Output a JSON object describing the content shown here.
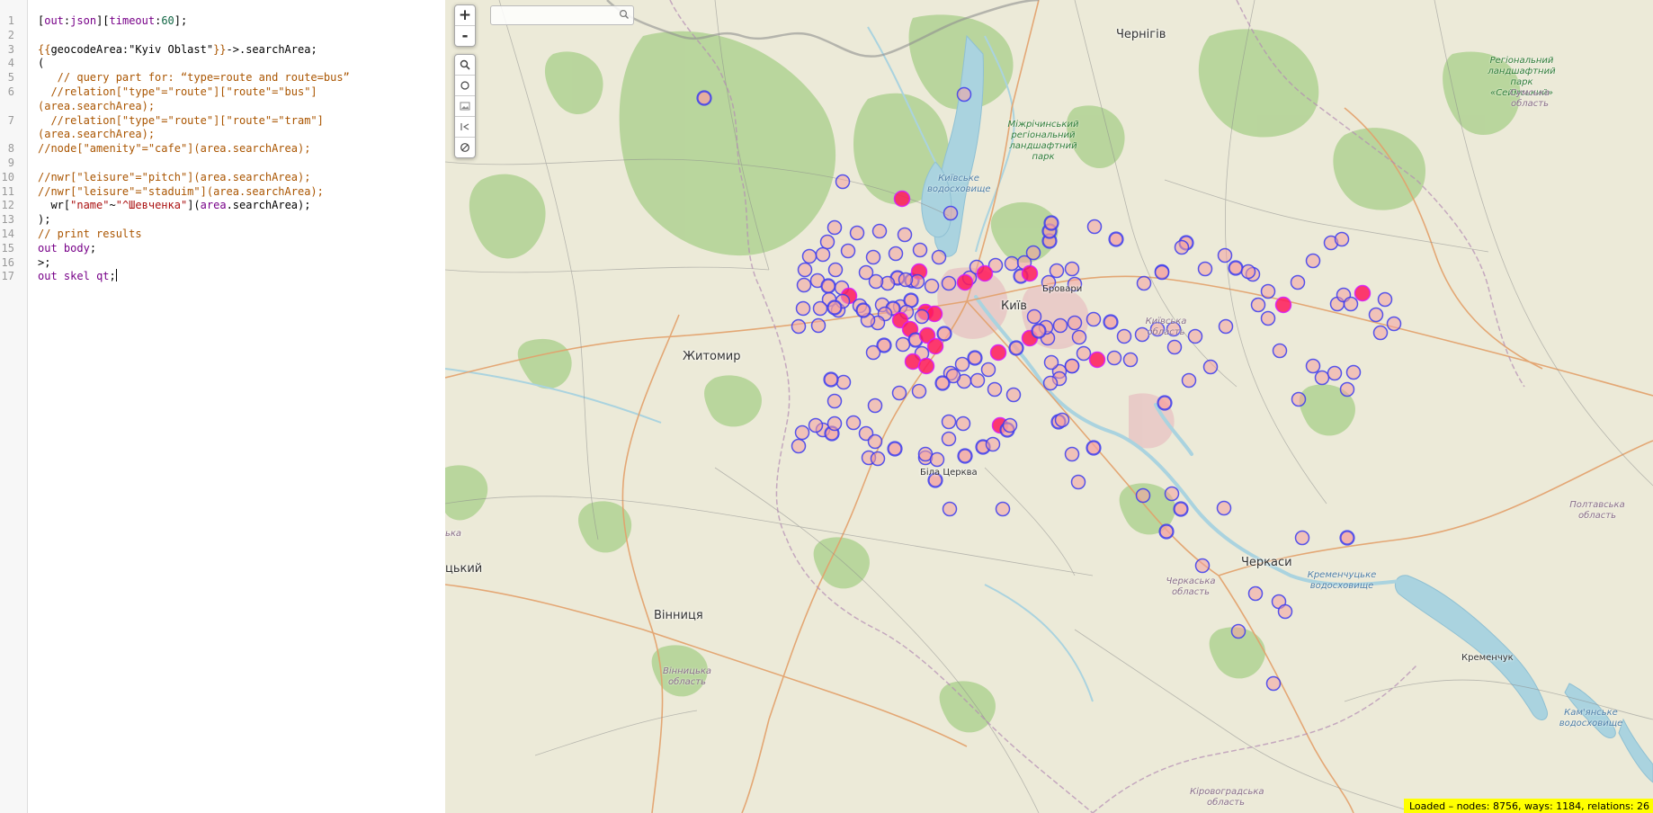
{
  "editor": {
    "lines": [
      {
        "n": "1",
        "tokens": [
          {
            "c": "t-plain",
            "t": "["
          },
          {
            "c": "t-kw",
            "t": "out"
          },
          {
            "c": "t-plain",
            "t": ":"
          },
          {
            "c": "t-kw",
            "t": "json"
          },
          {
            "c": "t-plain",
            "t": "]["
          },
          {
            "c": "t-kw",
            "t": "timeout"
          },
          {
            "c": "t-plain",
            "t": ":"
          },
          {
            "c": "t-num",
            "t": "60"
          },
          {
            "c": "t-plain",
            "t": "];"
          }
        ]
      },
      {
        "n": "2",
        "tokens": []
      },
      {
        "n": "3",
        "tokens": [
          {
            "c": "t-tmpl",
            "t": "{{"
          },
          {
            "c": "t-plain",
            "t": "geocodeArea:\"Kyiv Oblast\""
          },
          {
            "c": "t-tmpl",
            "t": "}}"
          },
          {
            "c": "t-plain",
            "t": "->.searchArea;"
          }
        ]
      },
      {
        "n": "4",
        "tokens": [
          {
            "c": "t-plain",
            "t": "("
          }
        ]
      },
      {
        "n": "5",
        "tokens": [
          {
            "c": "t-com",
            "t": "   // query part for: “type=route and route=bus”"
          }
        ]
      },
      {
        "n": "6",
        "tokens": [
          {
            "c": "t-com",
            "t": "  //relation[\"type\"=\"route\"][\"route\"=\"bus\"]"
          }
        ],
        "cont": [
          {
            "c": "t-com",
            "t": "(area.searchArea);"
          }
        ]
      },
      {
        "n": "7",
        "tokens": [
          {
            "c": "t-com",
            "t": "  //relation[\"type\"=\"route\"][\"route\"=\"tram\"]"
          }
        ],
        "cont": [
          {
            "c": "t-com",
            "t": "(area.searchArea);"
          }
        ]
      },
      {
        "n": "8",
        "tokens": [
          {
            "c": "t-com",
            "t": "//node[\"amenity\"=\"cafe\"](area.searchArea);"
          }
        ]
      },
      {
        "n": "9",
        "tokens": []
      },
      {
        "n": "10",
        "tokens": [
          {
            "c": "t-com",
            "t": "//nwr[\"leisure\"=\"pitch\"](area.searchArea);"
          }
        ]
      },
      {
        "n": "11",
        "tokens": [
          {
            "c": "t-com",
            "t": "//nwr[\"leisure\"=\"staduim\"](area.searchArea);"
          }
        ]
      },
      {
        "n": "12",
        "tokens": [
          {
            "c": "t-plain",
            "t": "  wr["
          },
          {
            "c": "t-str",
            "t": "\"name\""
          },
          {
            "c": "t-plain",
            "t": "~"
          },
          {
            "c": "t-str",
            "t": "\"^Шевченка\""
          },
          {
            "c": "t-plain",
            "t": "]("
          },
          {
            "c": "t-kw",
            "t": "area"
          },
          {
            "c": "t-plain",
            "t": ".searchArea);"
          }
        ]
      },
      {
        "n": "13",
        "tokens": [
          {
            "c": "t-plain",
            "t": ");"
          }
        ]
      },
      {
        "n": "14",
        "tokens": [
          {
            "c": "t-com",
            "t": "// print results"
          }
        ]
      },
      {
        "n": "15",
        "tokens": [
          {
            "c": "t-kw",
            "t": "out"
          },
          {
            "c": "t-plain",
            "t": " "
          },
          {
            "c": "t-kw",
            "t": "body"
          },
          {
            "c": "t-plain",
            "t": ";"
          }
        ]
      },
      {
        "n": "16",
        "tokens": [
          {
            "c": "t-plain",
            "t": ">;"
          }
        ]
      },
      {
        "n": "17",
        "tokens": [
          {
            "c": "t-kw",
            "t": "out"
          },
          {
            "c": "t-plain",
            "t": " "
          },
          {
            "c": "t-kw",
            "t": "skel"
          },
          {
            "c": "t-plain",
            "t": " "
          },
          {
            "c": "t-kw",
            "t": "qt"
          },
          {
            "c": "t-plain",
            "t": ";"
          }
        ],
        "cursor": true
      }
    ]
  },
  "map": {
    "controls": {
      "zoom_in": "+",
      "zoom_out": "-"
    },
    "search": {
      "placeholder": ""
    },
    "places": {
      "chernihiv": "Чернігів",
      "kyiv": "Київ",
      "brovary": "Бровари",
      "zhytomyr": "Житомир",
      "bila_tserkva": "Біла Церква",
      "vinnytsia": "Вінниця",
      "cherkasy": "Черкаси",
      "kremenchuk": "Кременчук",
      "left_edge_city": "цький",
      "left_edge_small": "ька"
    },
    "water_labels": {
      "kyiv_reservoir": "Київське водосховище",
      "kremenchuk_reservoir": "Кременчуцьке водосховище",
      "kaniv_reservoir": "Кам'янське водосховище"
    },
    "park_labels": {
      "mizhrichynskyi": "Міжрічинський регіональний ландшафтний парк",
      "seimskyi": "Регіональний ландшафтний парк «Сеймський»"
    },
    "region_labels": {
      "sumska": "Сумська область",
      "kyivska": "Київська область",
      "poltavska": "Полтавська область",
      "cherkaska": "Черкаська область",
      "vinnytska": "Вінницька область",
      "kirovohradska": "Кіровоградська область"
    },
    "colors": {
      "marker_stroke": "#3b3bf0",
      "marker_fill_light": "#f4a0a0",
      "marker_fill_dark": "#ff1a5a",
      "status_bg": "#ffff00"
    }
  },
  "status": {
    "text": "Loaded – nodes: 8756, ways: 1184, relations: 26"
  }
}
